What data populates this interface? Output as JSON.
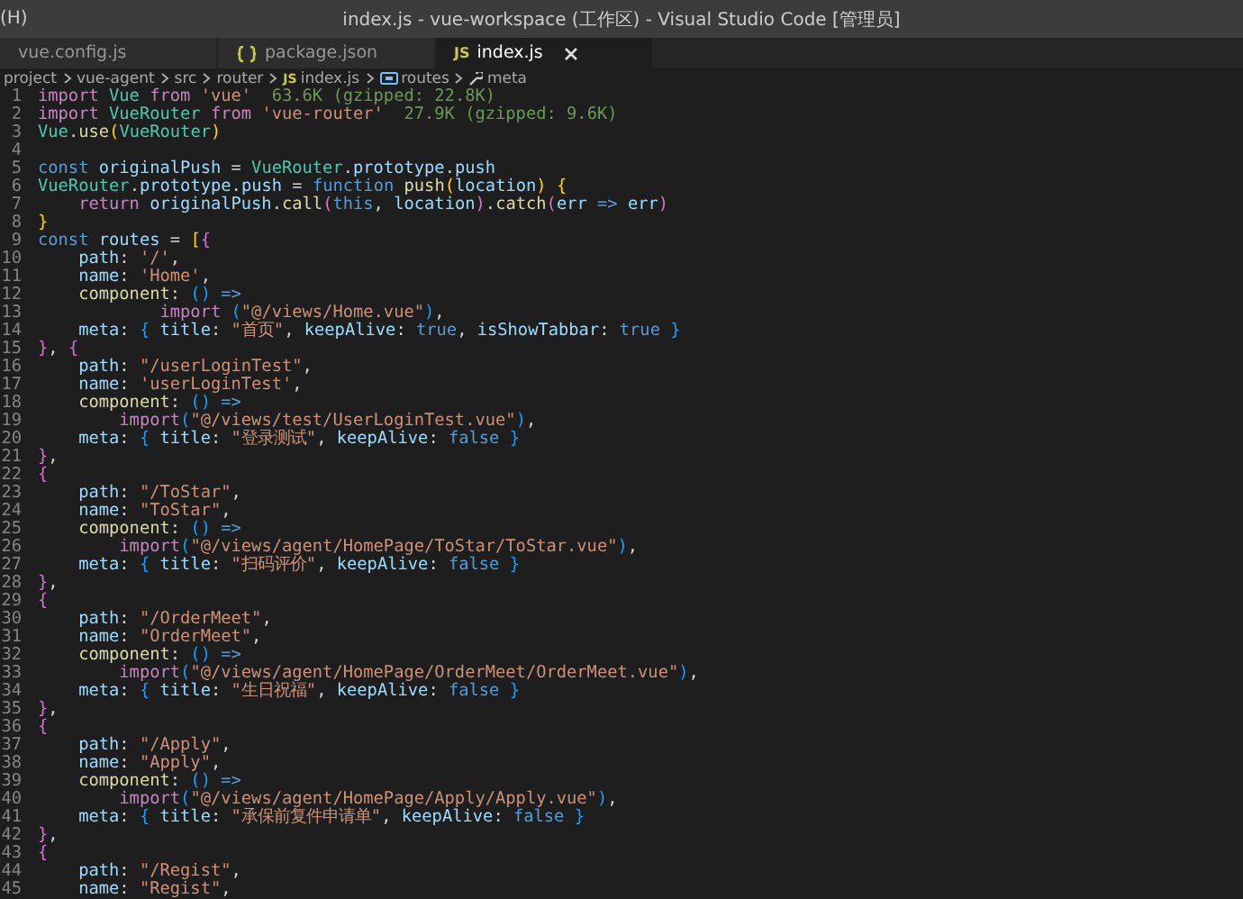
{
  "title_bar": {
    "menu_fragment": "(H)",
    "title": "index.js - vue-workspace (工作区) - Visual Studio Code [管理员]"
  },
  "tabs": [
    {
      "label": "vue.config.js",
      "kind": "cut",
      "selected": false
    },
    {
      "label": "package.json",
      "kind": "json",
      "selected": false
    },
    {
      "label": "index.js",
      "kind": "js",
      "badge": "JS",
      "selected": true
    }
  ],
  "breadcrumbs": [
    {
      "label": "project",
      "kind": "folder"
    },
    {
      "label": "vue-agent",
      "kind": "folder"
    },
    {
      "label": "src",
      "kind": "folder"
    },
    {
      "label": "router",
      "kind": "folder"
    },
    {
      "label": "index.js",
      "kind": "file",
      "badge": "JS"
    },
    {
      "label": "routes",
      "kind": "variable"
    },
    {
      "label": "meta",
      "kind": "property"
    }
  ],
  "code_lines": [
    {
      "number": "1",
      "tokens": [
        {
          "kind": "ctrl",
          "text": "import "
        },
        {
          "kind": "cls",
          "text": "Vue "
        },
        {
          "kind": "ctrl",
          "text": "from "
        },
        {
          "kind": "str",
          "text": "'vue'"
        },
        {
          "kind": "cost",
          "text": "  63.6K (gzipped: 22.8K)"
        }
      ]
    },
    {
      "number": "2",
      "tokens": [
        {
          "kind": "ctrl",
          "text": "import "
        },
        {
          "kind": "cls",
          "text": "VueRouter "
        },
        {
          "kind": "ctrl",
          "text": "from "
        },
        {
          "kind": "str",
          "text": "'vue-router'"
        },
        {
          "kind": "cost",
          "text": "  27.9K (gzipped: 9.6K)"
        }
      ]
    },
    {
      "number": "3",
      "tokens": [
        {
          "kind": "cls",
          "text": "Vue"
        },
        {
          "kind": "plain",
          "text": "."
        },
        {
          "kind": "fn",
          "text": "use"
        },
        {
          "kind": "b1",
          "text": "("
        },
        {
          "kind": "cls",
          "text": "VueRouter"
        },
        {
          "kind": "b1",
          "text": ")"
        }
      ]
    },
    {
      "number": "4"
    },
    {
      "number": "5",
      "tokens": [
        {
          "kind": "kw",
          "text": "const "
        },
        {
          "kind": "var",
          "text": "originalPush"
        },
        {
          "kind": "plain",
          "text": " = "
        },
        {
          "kind": "cls",
          "text": "VueRouter"
        },
        {
          "kind": "plain",
          "text": "."
        },
        {
          "kind": "var",
          "text": "prototype"
        },
        {
          "kind": "plain",
          "text": "."
        },
        {
          "kind": "var",
          "text": "push"
        }
      ]
    },
    {
      "number": "6",
      "tokens": [
        {
          "kind": "cls",
          "text": "VueRouter"
        },
        {
          "kind": "plain",
          "text": "."
        },
        {
          "kind": "var",
          "text": "prototype"
        },
        {
          "kind": "plain",
          "text": "."
        },
        {
          "kind": "var",
          "text": "push"
        },
        {
          "kind": "plain",
          "text": " = "
        },
        {
          "kind": "kw",
          "text": "function "
        },
        {
          "kind": "fn",
          "text": "push"
        },
        {
          "kind": "b1",
          "text": "("
        },
        {
          "kind": "var",
          "text": "location"
        },
        {
          "kind": "b1",
          "text": ") "
        },
        {
          "kind": "b1",
          "text": "{"
        }
      ]
    },
    {
      "number": "7",
      "tokens": [
        {
          "kind": "ctrl",
          "text": "    return "
        },
        {
          "kind": "var",
          "text": "originalPush"
        },
        {
          "kind": "plain",
          "text": "."
        },
        {
          "kind": "fn",
          "text": "call"
        },
        {
          "kind": "b2",
          "text": "("
        },
        {
          "kind": "kw",
          "text": "this"
        },
        {
          "kind": "plain",
          "text": ", "
        },
        {
          "kind": "var",
          "text": "location"
        },
        {
          "kind": "b2",
          "text": ")"
        },
        {
          "kind": "plain",
          "text": "."
        },
        {
          "kind": "fn",
          "text": "catch"
        },
        {
          "kind": "b2",
          "text": "("
        },
        {
          "kind": "var",
          "text": "err "
        },
        {
          "kind": "kw",
          "text": "=> "
        },
        {
          "kind": "var",
          "text": "err"
        },
        {
          "kind": "b2",
          "text": ")"
        }
      ]
    },
    {
      "number": "8",
      "tokens": [
        {
          "kind": "b1",
          "text": "}"
        }
      ]
    },
    {
      "number": "9",
      "tokens": [
        {
          "kind": "kw",
          "text": "const "
        },
        {
          "kind": "var",
          "text": "routes"
        },
        {
          "kind": "plain",
          "text": " = "
        },
        {
          "kind": "b1",
          "text": "["
        },
        {
          "kind": "b2",
          "text": "{"
        }
      ]
    },
    {
      "number": "10",
      "tokens": [
        {
          "kind": "var",
          "text": "    path"
        },
        {
          "kind": "plain",
          "text": ": "
        },
        {
          "kind": "str",
          "text": "'/'"
        },
        {
          "kind": "plain",
          "text": ","
        }
      ]
    },
    {
      "number": "11",
      "tokens": [
        {
          "kind": "var",
          "text": "    name"
        },
        {
          "kind": "plain",
          "text": ": "
        },
        {
          "kind": "str",
          "text": "'Home'"
        },
        {
          "kind": "plain",
          "text": ","
        }
      ]
    },
    {
      "number": "12",
      "tokens": [
        {
          "kind": "fn",
          "text": "    component"
        },
        {
          "kind": "plain",
          "text": ": "
        },
        {
          "kind": "b3",
          "text": "() "
        },
        {
          "kind": "kw",
          "text": "=>"
        }
      ]
    },
    {
      "number": "13",
      "tokens": [
        {
          "kind": "ctrl",
          "text": "            import "
        },
        {
          "kind": "b3",
          "text": "("
        },
        {
          "kind": "str",
          "text": "\"@/views/Home.vue\""
        },
        {
          "kind": "b3",
          "text": ")"
        },
        {
          "kind": "plain",
          "text": ","
        }
      ]
    },
    {
      "number": "14",
      "tokens": [
        {
          "kind": "var",
          "text": "    meta"
        },
        {
          "kind": "plain",
          "text": ": "
        },
        {
          "kind": "b3",
          "text": "{"
        },
        {
          "kind": "var",
          "text": " title"
        },
        {
          "kind": "plain",
          "text": ": "
        },
        {
          "kind": "str",
          "text": "\"首页\""
        },
        {
          "kind": "plain",
          "text": ", "
        },
        {
          "kind": "var",
          "text": "keepAlive"
        },
        {
          "kind": "plain",
          "text": ": "
        },
        {
          "kind": "kw",
          "text": "true"
        },
        {
          "kind": "plain",
          "text": ", "
        },
        {
          "kind": "var",
          "text": "isShowTabbar"
        },
        {
          "kind": "plain",
          "text": ": "
        },
        {
          "kind": "kw",
          "text": "true"
        },
        {
          "kind": "b3",
          "text": " }"
        }
      ]
    },
    {
      "number": "15",
      "tokens": [
        {
          "kind": "b2",
          "text": "}"
        },
        {
          "kind": "plain",
          "text": ", "
        },
        {
          "kind": "b2",
          "text": "{"
        }
      ]
    },
    {
      "number": "16",
      "tokens": [
        {
          "kind": "var",
          "text": "    path"
        },
        {
          "kind": "plain",
          "text": ": "
        },
        {
          "kind": "str",
          "text": "\"/userLoginTest\""
        },
        {
          "kind": "plain",
          "text": ","
        }
      ]
    },
    {
      "number": "17",
      "tokens": [
        {
          "kind": "var",
          "text": "    name"
        },
        {
          "kind": "plain",
          "text": ": "
        },
        {
          "kind": "str",
          "text": "'userLoginTest'"
        },
        {
          "kind": "plain",
          "text": ","
        }
      ]
    },
    {
      "number": "18",
      "tokens": [
        {
          "kind": "fn",
          "text": "    component"
        },
        {
          "kind": "plain",
          "text": ": "
        },
        {
          "kind": "b3",
          "text": "() "
        },
        {
          "kind": "kw",
          "text": "=>"
        }
      ]
    },
    {
      "number": "19",
      "tokens": [
        {
          "kind": "ctrl",
          "text": "        import"
        },
        {
          "kind": "b3",
          "text": "("
        },
        {
          "kind": "str",
          "text": "\"@/views/test/UserLoginTest.vue\""
        },
        {
          "kind": "b3",
          "text": ")"
        },
        {
          "kind": "plain",
          "text": ","
        }
      ]
    },
    {
      "number": "20",
      "tokens": [
        {
          "kind": "var",
          "text": "    meta"
        },
        {
          "kind": "plain",
          "text": ": "
        },
        {
          "kind": "b3",
          "text": "{"
        },
        {
          "kind": "var",
          "text": " title"
        },
        {
          "kind": "plain",
          "text": ": "
        },
        {
          "kind": "str",
          "text": "\"登录测试\""
        },
        {
          "kind": "plain",
          "text": ", "
        },
        {
          "kind": "var",
          "text": "keepAlive"
        },
        {
          "kind": "plain",
          "text": ": "
        },
        {
          "kind": "kw",
          "text": "false"
        },
        {
          "kind": "b3",
          "text": " }"
        }
      ]
    },
    {
      "number": "21",
      "tokens": [
        {
          "kind": "b2",
          "text": "}"
        },
        {
          "kind": "plain",
          "text": ","
        }
      ]
    },
    {
      "number": "22",
      "tokens": [
        {
          "kind": "b2",
          "text": "{"
        }
      ]
    },
    {
      "number": "23",
      "tokens": [
        {
          "kind": "var",
          "text": "    path"
        },
        {
          "kind": "plain",
          "text": ": "
        },
        {
          "kind": "str",
          "text": "\"/ToStar\""
        },
        {
          "kind": "plain",
          "text": ","
        }
      ]
    },
    {
      "number": "24",
      "tokens": [
        {
          "kind": "var",
          "text": "    name"
        },
        {
          "kind": "plain",
          "text": ": "
        },
        {
          "kind": "str",
          "text": "\"ToStar\""
        },
        {
          "kind": "plain",
          "text": ","
        }
      ]
    },
    {
      "number": "25",
      "tokens": [
        {
          "kind": "fn",
          "text": "    component"
        },
        {
          "kind": "plain",
          "text": ": "
        },
        {
          "kind": "b3",
          "text": "() "
        },
        {
          "kind": "kw",
          "text": "=>"
        }
      ]
    },
    {
      "number": "26",
      "tokens": [
        {
          "kind": "ctrl",
          "text": "        import"
        },
        {
          "kind": "b3",
          "text": "("
        },
        {
          "kind": "str",
          "text": "\"@/views/agent/HomePage/ToStar/ToStar.vue\""
        },
        {
          "kind": "b3",
          "text": ")"
        },
        {
          "kind": "plain",
          "text": ","
        }
      ]
    },
    {
      "number": "27",
      "tokens": [
        {
          "kind": "var",
          "text": "    meta"
        },
        {
          "kind": "plain",
          "text": ": "
        },
        {
          "kind": "b3",
          "text": "{"
        },
        {
          "kind": "var",
          "text": " title"
        },
        {
          "kind": "plain",
          "text": ": "
        },
        {
          "kind": "str",
          "text": "\"扫码评价\""
        },
        {
          "kind": "plain",
          "text": ", "
        },
        {
          "kind": "var",
          "text": "keepAlive"
        },
        {
          "kind": "plain",
          "text": ": "
        },
        {
          "kind": "kw",
          "text": "false"
        },
        {
          "kind": "b3",
          "text": " }"
        }
      ]
    },
    {
      "number": "28",
      "tokens": [
        {
          "kind": "b2",
          "text": "}"
        },
        {
          "kind": "plain",
          "text": ","
        }
      ]
    },
    {
      "number": "29",
      "tokens": [
        {
          "kind": "b2",
          "text": "{"
        }
      ]
    },
    {
      "number": "30",
      "tokens": [
        {
          "kind": "var",
          "text": "    path"
        },
        {
          "kind": "plain",
          "text": ": "
        },
        {
          "kind": "str",
          "text": "\"/OrderMeet\""
        },
        {
          "kind": "plain",
          "text": ","
        }
      ]
    },
    {
      "number": "31",
      "tokens": [
        {
          "kind": "var",
          "text": "    name"
        },
        {
          "kind": "plain",
          "text": ": "
        },
        {
          "kind": "str",
          "text": "\"OrderMeet\""
        },
        {
          "kind": "plain",
          "text": ","
        }
      ]
    },
    {
      "number": "32",
      "tokens": [
        {
          "kind": "fn",
          "text": "    component"
        },
        {
          "kind": "plain",
          "text": ": "
        },
        {
          "kind": "b3",
          "text": "() "
        },
        {
          "kind": "kw",
          "text": "=>"
        }
      ]
    },
    {
      "number": "33",
      "tokens": [
        {
          "kind": "ctrl",
          "text": "        import"
        },
        {
          "kind": "b3",
          "text": "("
        },
        {
          "kind": "str",
          "text": "\"@/views/agent/HomePage/OrderMeet/OrderMeet.vue\""
        },
        {
          "kind": "b3",
          "text": ")"
        },
        {
          "kind": "plain",
          "text": ","
        }
      ]
    },
    {
      "number": "34",
      "tokens": [
        {
          "kind": "var",
          "text": "    meta"
        },
        {
          "kind": "plain",
          "text": ": "
        },
        {
          "kind": "b3",
          "text": "{"
        },
        {
          "kind": "var",
          "text": " title"
        },
        {
          "kind": "plain",
          "text": ": "
        },
        {
          "kind": "str",
          "text": "\"生日祝福\""
        },
        {
          "kind": "plain",
          "text": ", "
        },
        {
          "kind": "var",
          "text": "keepAlive"
        },
        {
          "kind": "plain",
          "text": ": "
        },
        {
          "kind": "kw",
          "text": "false"
        },
        {
          "kind": "b3",
          "text": " }"
        }
      ]
    },
    {
      "number": "35",
      "tokens": [
        {
          "kind": "b2",
          "text": "}"
        },
        {
          "kind": "plain",
          "text": ","
        }
      ]
    },
    {
      "number": "36",
      "tokens": [
        {
          "kind": "b2",
          "text": "{"
        }
      ]
    },
    {
      "number": "37",
      "tokens": [
        {
          "kind": "var",
          "text": "    path"
        },
        {
          "kind": "plain",
          "text": ": "
        },
        {
          "kind": "str",
          "text": "\"/Apply\""
        },
        {
          "kind": "plain",
          "text": ","
        }
      ]
    },
    {
      "number": "38",
      "tokens": [
        {
          "kind": "var",
          "text": "    name"
        },
        {
          "kind": "plain",
          "text": ": "
        },
        {
          "kind": "str",
          "text": "\"Apply\""
        },
        {
          "kind": "plain",
          "text": ","
        }
      ]
    },
    {
      "number": "39",
      "tokens": [
        {
          "kind": "fn",
          "text": "    component"
        },
        {
          "kind": "plain",
          "text": ": "
        },
        {
          "kind": "b3",
          "text": "() "
        },
        {
          "kind": "kw",
          "text": "=>"
        }
      ]
    },
    {
      "number": "40",
      "tokens": [
        {
          "kind": "ctrl",
          "text": "        import"
        },
        {
          "kind": "b3",
          "text": "("
        },
        {
          "kind": "str",
          "text": "\"@/views/agent/HomePage/Apply/Apply.vue\""
        },
        {
          "kind": "b3",
          "text": ")"
        },
        {
          "kind": "plain",
          "text": ","
        }
      ]
    },
    {
      "number": "41",
      "tokens": [
        {
          "kind": "var",
          "text": "    meta"
        },
        {
          "kind": "plain",
          "text": ": "
        },
        {
          "kind": "b3",
          "text": "{"
        },
        {
          "kind": "var",
          "text": " title"
        },
        {
          "kind": "plain",
          "text": ": "
        },
        {
          "kind": "str",
          "text": "\"承保前复件申请单\""
        },
        {
          "kind": "plain",
          "text": ", "
        },
        {
          "kind": "var",
          "text": "keepAlive"
        },
        {
          "kind": "plain",
          "text": ": "
        },
        {
          "kind": "kw",
          "text": "false"
        },
        {
          "kind": "b3",
          "text": " }"
        }
      ]
    },
    {
      "number": "42",
      "tokens": [
        {
          "kind": "b2",
          "text": "}"
        },
        {
          "kind": "plain",
          "text": ","
        }
      ]
    },
    {
      "number": "43",
      "tokens": [
        {
          "kind": "b2",
          "text": "{"
        }
      ]
    },
    {
      "number": "44",
      "tokens": [
        {
          "kind": "var",
          "text": "    path"
        },
        {
          "kind": "plain",
          "text": ": "
        },
        {
          "kind": "str",
          "text": "\"/Regist\""
        },
        {
          "kind": "plain",
          "text": ","
        }
      ]
    },
    {
      "number": "45",
      "tokens": [
        {
          "kind": "var",
          "text": "    name"
        },
        {
          "kind": "plain",
          "text": ": "
        },
        {
          "kind": "str",
          "text": "\"Regist\""
        },
        {
          "kind": "plain",
          "text": ","
        }
      ]
    }
  ]
}
